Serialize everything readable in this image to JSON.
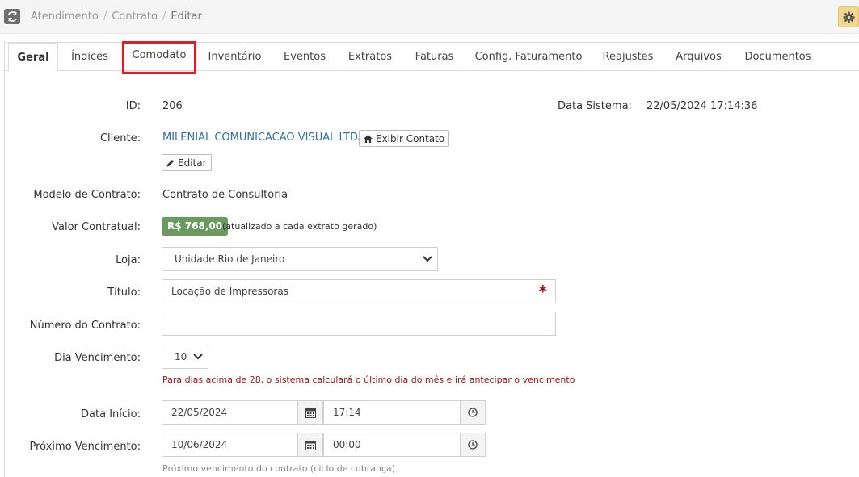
{
  "breadcrumb": {
    "items": [
      "Atendimento",
      "Contrato",
      "Editar"
    ],
    "separator": "/"
  },
  "tabs": [
    {
      "label": "Geral"
    },
    {
      "label": "Índices"
    },
    {
      "label": "Comodato"
    },
    {
      "label": "Inventário"
    },
    {
      "label": "Eventos"
    },
    {
      "label": "Extratos"
    },
    {
      "label": "Faturas"
    },
    {
      "label": "Config. Faturamento"
    },
    {
      "label": "Reajustes"
    },
    {
      "label": "Arquivos"
    },
    {
      "label": "Documentos"
    }
  ],
  "active_tab": "Geral",
  "highlighted_tab": "Comodato",
  "form": {
    "id_label": "ID:",
    "id_value": "206",
    "data_sistema_label": "Data Sistema:",
    "data_sistema_value": "22/05/2024 17:14:36",
    "cliente_label": "Cliente:",
    "cliente_value": "MILENIAL COMUNICACAO VISUAL LTDA",
    "exibir_contato_label": "Exibir Contato",
    "editar_label": "Editar",
    "modelo_label": "Modelo de Contrato:",
    "modelo_value": "Contrato de Consultoria",
    "valor_label": "Valor Contratual:",
    "valor_value": "R$ 768,00",
    "valor_note": "(atualizado a cada extrato gerado)",
    "loja_label": "Loja:",
    "loja_value": "Unidade Rio de Janeiro",
    "titulo_label": "Título:",
    "titulo_value": "Locação de Impressoras",
    "titulo_required": "*",
    "numero_label": "Número do Contrato:",
    "numero_value": "",
    "dia_label": "Dia Vencimento:",
    "dia_value": "10",
    "dia_hint": "Para dias acima de 28, o sistema calculará o último dia do mês e irá antecipar o vencimento",
    "inicio_label": "Data Início:",
    "inicio_date": "22/05/2024",
    "inicio_time": "17:14",
    "proximo_label": "Próximo Vencimento:",
    "proximo_date": "10/06/2024",
    "proximo_time": "00:00",
    "proximo_hint": "Próximo vencimento do contrato (ciclo de cobrança)."
  },
  "colors": {
    "link": "#3070a8",
    "badge": "#6a9a5d",
    "required": "#a3141a",
    "highlight": "#e21b22"
  },
  "icons": [
    "refresh-icon",
    "gear-icon",
    "home-icon",
    "pencil-icon",
    "chevron-down-icon",
    "calendar-icon",
    "clock-icon"
  ]
}
